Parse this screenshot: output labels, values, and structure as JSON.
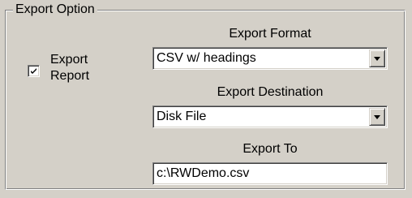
{
  "group": {
    "title": "Export Option"
  },
  "export_report": {
    "label_line1": "Export",
    "label_line2": "Report",
    "checked": true
  },
  "export_format": {
    "label": "Export Format",
    "selected": "CSV w/ headings"
  },
  "export_destination": {
    "label": "Export Destination",
    "selected": "Disk File"
  },
  "export_to": {
    "label": "Export To",
    "value": "c:\\RWDemo.csv"
  },
  "icons": {
    "checkbox_mark": "check-mark-icon",
    "dropdown_arrow": "down-arrow-icon"
  }
}
